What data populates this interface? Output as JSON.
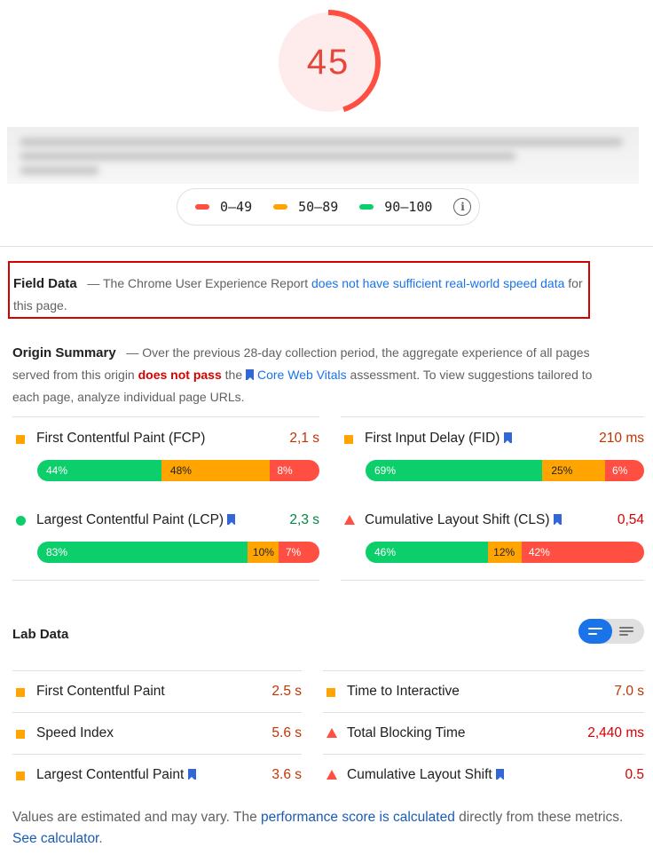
{
  "score": {
    "value": "45",
    "fraction": 0.45,
    "color": "#ff4e42"
  },
  "legend": {
    "items": [
      {
        "label": "0–49",
        "color": "#ff4e42"
      },
      {
        "label": "50–89",
        "color": "#ffa400"
      },
      {
        "label": "90–100",
        "color": "#0cce6b"
      }
    ],
    "info_icon": "info-icon"
  },
  "field_data": {
    "title": "Field Data",
    "dash": "—",
    "text_before": "The Chrome User Experience Report",
    "link_text": "does not have sufficient real-world speed data",
    "text_after": "for this page."
  },
  "origin_summary": {
    "title": "Origin Summary",
    "dash": "—",
    "text1": "Over the previous 28-day collection period, the aggregate experience of all pages served from this origin",
    "status": "does not pass",
    "text2": "the",
    "cwv_link": "Core Web Vitals",
    "text3": "assessment. To view suggestions tailored to each page, analyze individual page URLs."
  },
  "field_metrics": {
    "left": [
      {
        "name": "First Contentful Paint (FCP)",
        "value": "2,1 s",
        "value_color": "#c33300",
        "indicator": "square",
        "dist": [
          "44%",
          "48%",
          "8%"
        ],
        "fractions": [
          0.44,
          0.48,
          0.08
        ]
      },
      {
        "name": "Largest Contentful Paint (LCP)",
        "value": "2,3 s",
        "value_color": "#018642",
        "indicator": "circle",
        "bookmark": true,
        "dist": [
          "83%",
          "10%",
          "7%"
        ],
        "fractions": [
          0.83,
          0.1,
          0.07
        ]
      }
    ],
    "right": [
      {
        "name": "First Input Delay (FID)",
        "value": "210 ms",
        "value_color": "#c33300",
        "indicator": "square",
        "bookmark": true,
        "dist": [
          "69%",
          "25%",
          "6%"
        ],
        "fractions": [
          0.69,
          0.25,
          0.06
        ]
      },
      {
        "name": "Cumulative Layout Shift (CLS)",
        "value": "0,54",
        "value_color": "#d50000",
        "indicator": "triangle",
        "bookmark": true,
        "dist": [
          "46%",
          "12%",
          "42%"
        ],
        "fractions": [
          0.46,
          0.12,
          0.42
        ]
      }
    ]
  },
  "lab_data": {
    "title": "Lab Data",
    "left": [
      {
        "name": "First Contentful Paint",
        "value": "2.5 s",
        "value_color": "#c33300",
        "indicator": "square"
      },
      {
        "name": "Speed Index",
        "value": "5.6 s",
        "value_color": "#c33300",
        "indicator": "square"
      },
      {
        "name": "Largest Contentful Paint",
        "value": "3.6 s",
        "value_color": "#c33300",
        "indicator": "square",
        "bookmark": true
      }
    ],
    "right": [
      {
        "name": "Time to Interactive",
        "value": "7.0 s",
        "value_color": "#c33300",
        "indicator": "square"
      },
      {
        "name": "Total Blocking Time",
        "value": "2,440 ms",
        "value_color": "#d50000",
        "indicator": "triangle"
      },
      {
        "name": "Cumulative Layout Shift",
        "value": "0.5",
        "value_color": "#d50000",
        "indicator": "triangle",
        "bookmark": true
      }
    ]
  },
  "footnote": {
    "text1": "Values are estimated and may vary. The",
    "link1": "performance score is calculated",
    "text2": "directly from these metrics.",
    "link2": "See calculator",
    "text3": "."
  }
}
